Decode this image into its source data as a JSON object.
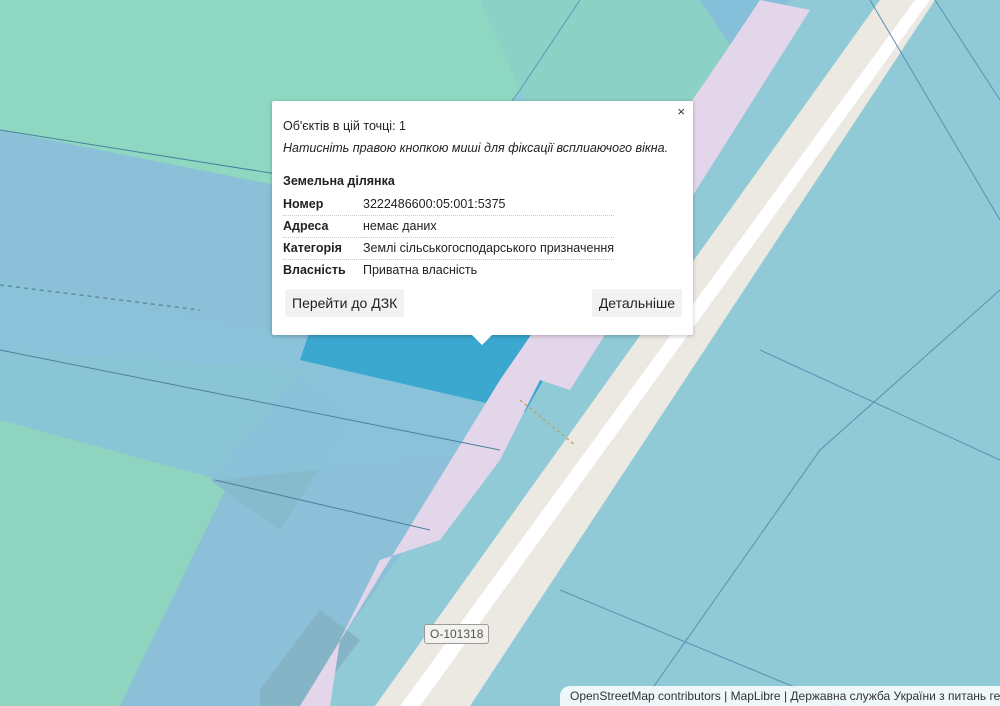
{
  "map": {
    "road_ref": "O-101318",
    "colors": {
      "parcel_blue": "#8fc4d6",
      "parcel_green": "#8ed7c0",
      "parcel_selected": "#3ba7cf",
      "road_casing": "#f0ede8",
      "road_fill": "#ffffff",
      "landuse_pink": "#e5d3e8"
    }
  },
  "popup": {
    "close_label": "×",
    "objects_count": "Об'єктів в цій точці: 1",
    "hint": "Натисніть правою кнопкою миші для фіксації всплиаючого вікна.",
    "heading": "Земельна ділянка",
    "attributes": [
      {
        "key": "Номер",
        "value": "3222486600:05:001:5375"
      },
      {
        "key": "Адреса",
        "value": "немає даних"
      },
      {
        "key": "Категорія",
        "value": "Землі сільськогосподарського призначення"
      },
      {
        "key": "Власність",
        "value": "Приватна власність"
      }
    ],
    "buttons": {
      "go_to_dzk": "Перейти до ДЗК",
      "details": "Детальніше"
    }
  },
  "attribution": {
    "osm": "OpenStreetMap contributors",
    "maplibre": "MapLibre",
    "state_service": "Державна служба України з питань геодезії, картографії та кадастру",
    "separator": "|"
  }
}
